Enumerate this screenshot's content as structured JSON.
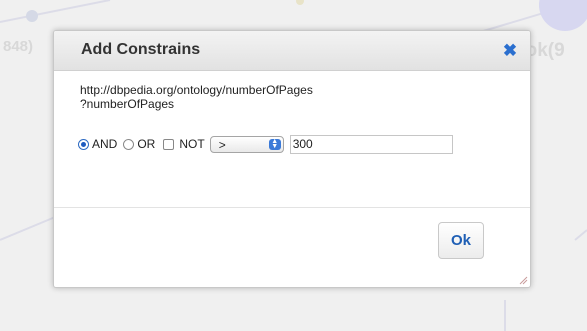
{
  "background": {
    "left_label": "848)",
    "right_label": "ook(9"
  },
  "dialog": {
    "title": "Add Constrains",
    "close_icon": "close-x-icon",
    "property_uri": "http://dbpedia.org/ontology/numberOfPages",
    "variable": "?numberOfPages",
    "options": {
      "and_label": "AND",
      "or_label": "OR",
      "not_label": "NOT",
      "selected_radio": "AND",
      "not_checked": false
    },
    "operator": {
      "selected": ">"
    },
    "value_input": {
      "value": "300"
    },
    "ok_label": "Ok"
  },
  "colors": {
    "accent": "#1f5fb5",
    "close": "#2a6fcf"
  }
}
